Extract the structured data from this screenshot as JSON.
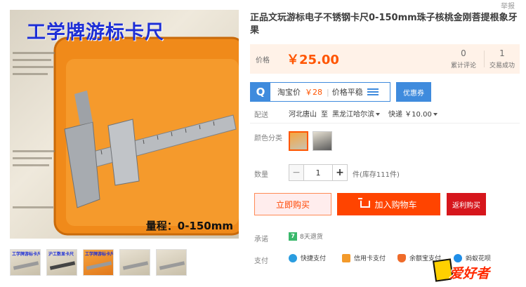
{
  "top_tag": "举报",
  "gallery": {
    "banner_text": "工学牌游标卡尺",
    "range_text": "量程：0-150mm",
    "thumbnails": [
      {
        "label": "工学牌游标卡尺"
      },
      {
        "label": "沪工数显卡尺"
      },
      {
        "label": "工学牌游标卡尺"
      },
      {
        "label": ""
      },
      {
        "label": ""
      }
    ]
  },
  "product": {
    "title": "正品文玩游标电子不锈钢卡尺0-150mm珠子核桃金刚菩提根象牙果"
  },
  "price": {
    "label": "价格",
    "value": "￥25.00",
    "reviews_count": "0",
    "reviews_label": "累计评论",
    "sales_count": "1",
    "sales_label": "交易成功"
  },
  "taobao": {
    "logo": "Q",
    "label": "淘宝价",
    "price": "￥28",
    "trend": "价格平稳",
    "coupon_label": "优惠券"
  },
  "delivery": {
    "label": "配送",
    "from": "河北唐山",
    "to_word": "至",
    "to": "黑龙江哈尔滨",
    "shipping": "快递 ￥10.00"
  },
  "color": {
    "label": "颜色分类"
  },
  "quantity": {
    "label": "数量",
    "minus": "−",
    "value": "1",
    "plus": "+",
    "stock": "件(库存111件)"
  },
  "actions": {
    "buy_now": "立即购买",
    "add_to_cart": "加入购物车",
    "cashback": "返利购买"
  },
  "promise": {
    "label": "承诺",
    "icon": "7",
    "text": "8天退货"
  },
  "payment": {
    "label": "支付",
    "methods": [
      {
        "name": "快捷支付"
      },
      {
        "name": "信用卡支付"
      },
      {
        "name": "余额宝支付"
      },
      {
        "name": "蚂蚁花呗"
      }
    ]
  },
  "watermark": {
    "text": "爱好者"
  },
  "colors": {
    "accent": "#ff4400",
    "price": "#ff5500",
    "taobao_blue": "#3f8bdd",
    "cashback_red": "#d6161c",
    "price_bg": "#fff2e8"
  }
}
